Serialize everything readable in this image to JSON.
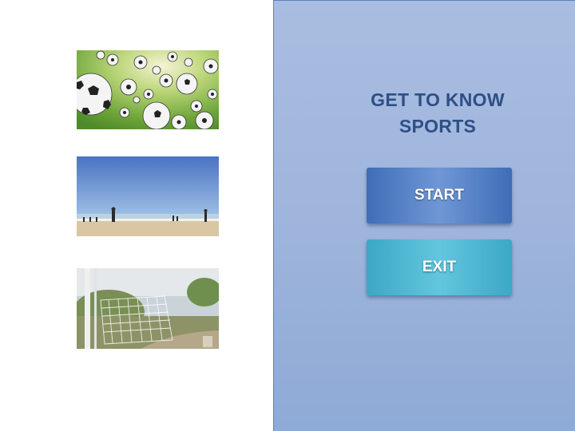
{
  "title": {
    "line1": "GET TO KNOW",
    "line2": "SPORTS"
  },
  "buttons": {
    "start_label": "START",
    "exit_label": "EXIT"
  },
  "colors": {
    "title_text": "#2e4f86",
    "panel_background": "#a9bde0",
    "start_button": "#4a78c0",
    "exit_button": "#45b2cf"
  },
  "images": [
    {
      "name": "soccer-balls-photo"
    },
    {
      "name": "beach-soccer-photo"
    },
    {
      "name": "soccer-goal-net-photo"
    }
  ]
}
